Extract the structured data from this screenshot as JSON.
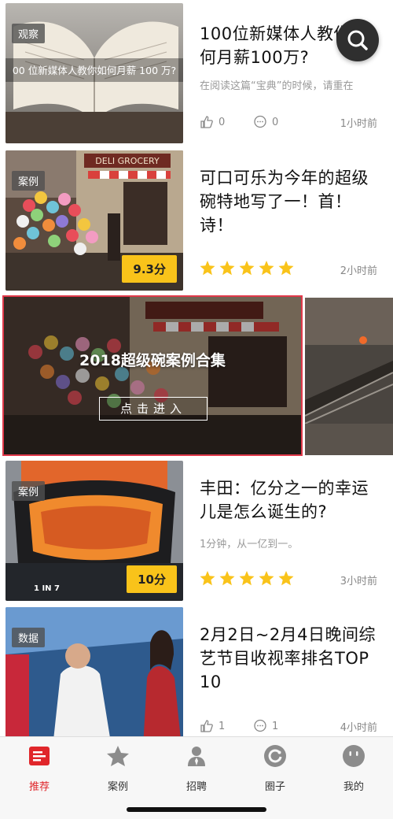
{
  "articles": [
    {
      "tag": "观察",
      "title": "100位新媒体人教你如何月薪100万?",
      "summary": "在阅读这篇“宝典”的时候，请重在",
      "image_caption": "00 位新媒体人教你如何月薪 100 万?",
      "likes": "0",
      "comments": "0",
      "time_ago": "1小时前"
    },
    {
      "tag": "案例",
      "title": "可口可乐为今年的超级碗特地写了一！首！诗！",
      "score": "9.3分",
      "rating_stars": 5,
      "time_ago": "2小时前",
      "sign_text": "DELI GROCERY"
    },
    {
      "tag": "案例",
      "title": "丰田：亿分之一的幸运儿是怎么诞生的?",
      "summary": "1分钟，从一亿到一。",
      "score": "10分",
      "rating_stars": 5,
      "time_ago": "3小时前",
      "overlay_text": "1 IN 7"
    },
    {
      "tag": "数据",
      "title": "2月2日~2月4日晚间综艺节目收视率排名TOP 10",
      "likes": "1",
      "comments": "1",
      "time_ago": "4小时前"
    }
  ],
  "banner": {
    "title": "2018超级碗案例合集",
    "button": "点击进入"
  },
  "tabbar": [
    {
      "label": "推荐",
      "icon": "recommend-icon",
      "active": true
    },
    {
      "label": "案例",
      "icon": "star-icon"
    },
    {
      "label": "招聘",
      "icon": "person-icon"
    },
    {
      "label": "圈子",
      "icon": "circle-icon"
    },
    {
      "label": "我的",
      "icon": "face-icon"
    }
  ],
  "colors": {
    "accent": "#e0262b",
    "star": "#f9c31a",
    "banner_border": "#e0394a"
  }
}
